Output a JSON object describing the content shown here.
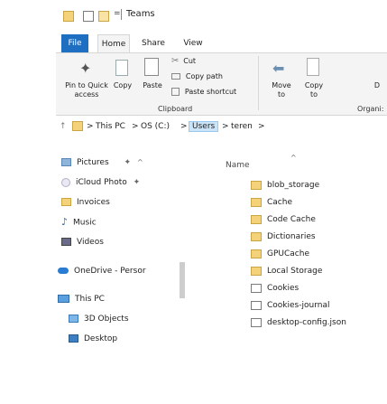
{
  "window": {
    "title": "Teams"
  },
  "quick_access_toolbar": {
    "dropdown_glyph": "="
  },
  "ribbon": {
    "tabs": [
      "File",
      "Home",
      "Share",
      "View"
    ],
    "clipboard": {
      "pin_label_line1": "Pin to Quick",
      "pin_label_line2": "access",
      "copy_label": "Copy",
      "paste_label": "Paste",
      "cut_label": "Cut",
      "copy_path_label": "Copy path",
      "paste_shortcut_label": "Paste shortcut",
      "group_label": "Clipboard"
    },
    "organize": {
      "move_to_line1": "Move",
      "move_to_line2": "to",
      "copy_to_line1": "Copy",
      "copy_to_line2": "to",
      "delete_partial": "D",
      "group_label_partial": "Organi:"
    }
  },
  "address_bar": {
    "crumbs": [
      "This PC",
      "OS (C:)",
      "Users",
      "teren"
    ],
    "separator": ">",
    "active_crumb": "Users"
  },
  "navigation_pane": {
    "items": [
      {
        "label": "Pictures",
        "icon": "pictures-icon",
        "pinned": true
      },
      {
        "label": "iCloud Photo",
        "icon": "icloud-photos-icon",
        "pinned": true
      },
      {
        "label": "Invoices",
        "icon": "folder-icon"
      },
      {
        "label": "Music",
        "icon": "music-icon"
      },
      {
        "label": "Videos",
        "icon": "videos-icon"
      },
      {
        "label": "OneDrive - Persor",
        "icon": "onedrive-icon"
      },
      {
        "label": "This PC",
        "icon": "computer-icon"
      },
      {
        "label": "3D Objects",
        "icon": "3d-objects-icon"
      },
      {
        "label": "Desktop",
        "icon": "desktop-icon"
      }
    ]
  },
  "file_list": {
    "column_header": "Name",
    "items": [
      {
        "name": "blob_storage",
        "type": "folder"
      },
      {
        "name": "Cache",
        "type": "folder"
      },
      {
        "name": "Code Cache",
        "type": "folder"
      },
      {
        "name": "Dictionaries",
        "type": "folder"
      },
      {
        "name": "GPUCache",
        "type": "folder"
      },
      {
        "name": "Local Storage",
        "type": "folder"
      },
      {
        "name": "Cookies",
        "type": "file"
      },
      {
        "name": "Cookies-journal",
        "type": "file"
      },
      {
        "name": "desktop-config.json",
        "type": "file"
      }
    ]
  },
  "colors": {
    "file_tab": "#1e6fc2",
    "folder_fill": "#f3d27a",
    "active_crumb_bg": "#cce4f7"
  }
}
